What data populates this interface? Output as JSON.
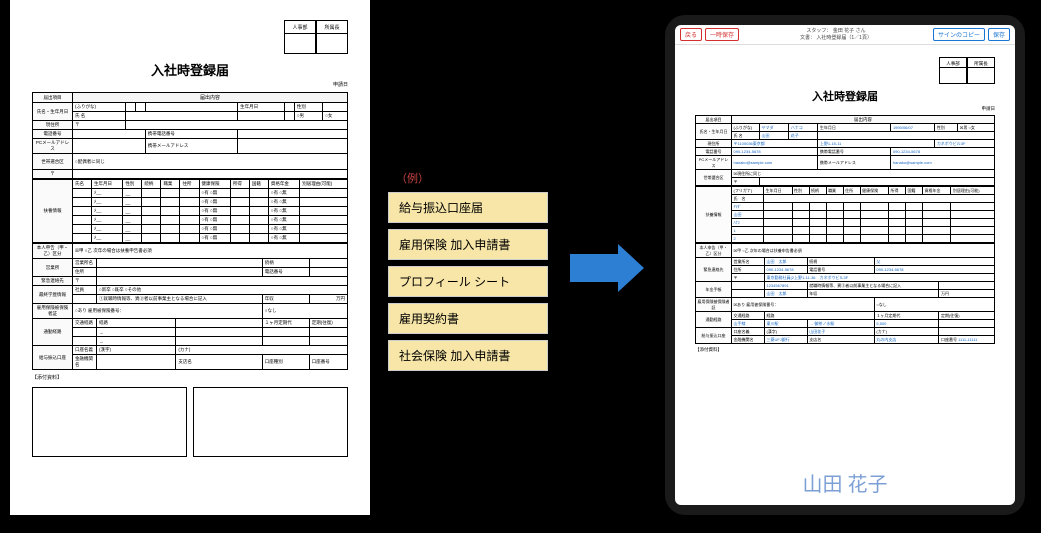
{
  "form_title": "入社時登録届",
  "applicant_label": "申請日",
  "stamp_labels": [
    "人事部",
    "所属長"
  ],
  "paper_sections": {
    "section1_hdr": "届出内容",
    "row_item": "届出項目",
    "name_row": "氏名・生年月日",
    "furigana": "(ふりがな)",
    "name_label": "氏   名",
    "birth_label": "生年月日",
    "gender_label": "性別",
    "gender_m": "○男",
    "gender_f": "○女",
    "addr": "現住所",
    "addr_post": "〒",
    "tel": "電話番号",
    "mobile": "携帯電話番号",
    "pcmail": "PCメールアドレス",
    "mobmail": "携帯メールアドレス",
    "commute": "世帯選合区",
    "commute_opt": "○配偶者に同じ",
    "section2": "扶養情報",
    "col_headers": [
      "氏名",
      "生年月日",
      "性別",
      "続柄",
      "職業",
      "住所",
      "健康保険",
      "所得",
      "国籍",
      "資格年金",
      "別居理由(可能)"
    ],
    "yes_no": "○有 ○無",
    "section3_note": "本人申告（甲・乙）区分",
    "section3_radio": "☒甲   ○乙 次年の場合は扶養申告書必須",
    "work": "営業所",
    "work_name": "営業所名",
    "work_cont": "続柄",
    "emerg": "緊急連絡先",
    "emerg_addr": "住所",
    "emerg_tel": "電話番号",
    "career": "最終学歴情報",
    "seibetsu": "社員",
    "seibetsu_opts": "○新卒   ○既卒    ○その他",
    "employ_radio": "①就職時情報等、異②者以前事業主となる場合に記入",
    "year_income": "年収",
    "yen": "万円",
    "insurance": "雇用保険被保険者証",
    "insurance_opts": "○あり 雇用被保険番号：",
    "insurance_none": "○なし",
    "commute2": "交通経路",
    "route": "経路",
    "month_fee": "１ヶ月定期代",
    "pass_dist": "定期(往復)",
    "commute_route": "通勤経路",
    "arrow_sep": "→",
    "bank": "給与振込口座",
    "account_holder": "口座名義",
    "kanji": "(漢字)",
    "kana": "(カナ)",
    "bank_name": "金融機関名",
    "branch": "支店名",
    "acct_type": "口座種別",
    "acct_no": "口座番号",
    "attach": "【添付資料】"
  },
  "center_note": "（例）",
  "center_items": [
    "給与振込口座届",
    "雇用保険 加入申請書",
    "プロフィール シート",
    "雇用契約書",
    "社会保険 加入申請書"
  ],
  "tablet_toolbar": {
    "back": "戻る",
    "save_draft": "一時保存",
    "staff_line": "スタッフ：  金田 花子  さん",
    "doc_line": "文書：        入社時登録届（1／1頁）",
    "copy_sign": "サインのコピー",
    "save": "保存"
  },
  "tablet_data": {
    "kana_last": "ヤマダ",
    "kana_first": "ハナコ",
    "name_last": "山田",
    "name_first": "花子",
    "birth": "1990/06/07",
    "gender_checked": "☒男   ○女",
    "post": "〒1100036東京都",
    "addr1": "上野1-15-11",
    "addr2": "カネボウビル3F",
    "tel": "090-1234-5678",
    "mobile": "090-1234-5678",
    "pcmail": "hanako@sample.com",
    "mobmail": "hanako@sample.com",
    "commute_chk": "☒現住所に同じ",
    "dep_kana": "(フリガナ)",
    "dep_name": "氏　名",
    "dep1_kana": "ﾔﾏﾀﾞ",
    "dep1_name": "山田",
    "dep2_kana": "ﾊﾅｺ",
    "dep2_name": "1",
    "dep3_name": "2",
    "section3_chk": "☒甲   ○乙 次年の場合は扶養申告書必須",
    "work_name": "山田　太郎",
    "work_cont": "父",
    "emerg_addr": "090-1234-5678",
    "emerg_tel": "090-1234-5678",
    "career_val": "東京勤務社員(2上野1-11-36　カネボウビル3F",
    "year_post": "年金手帳",
    "year_no": "1234567891",
    "emp_radio": "就職時情報等、異②者以前事業主となる場合に記入",
    "ins_yes": "☒あり 雇用被保険番号：",
    "ins_name": "山田　太郎",
    "ins_no": "○なし",
    "ins_none_chk": "○なし",
    "route_from": "山手線",
    "route_via": "東川駅",
    "route_to": "御茶ノ水駅",
    "month_fee": "5,500",
    "acct_name": "山田花子",
    "bank_name": "三菱UFJ銀行",
    "branch": "丸の内支店",
    "acct_type": "普通",
    "acct_no": "1111-11111"
  },
  "signature": "山田 花子"
}
